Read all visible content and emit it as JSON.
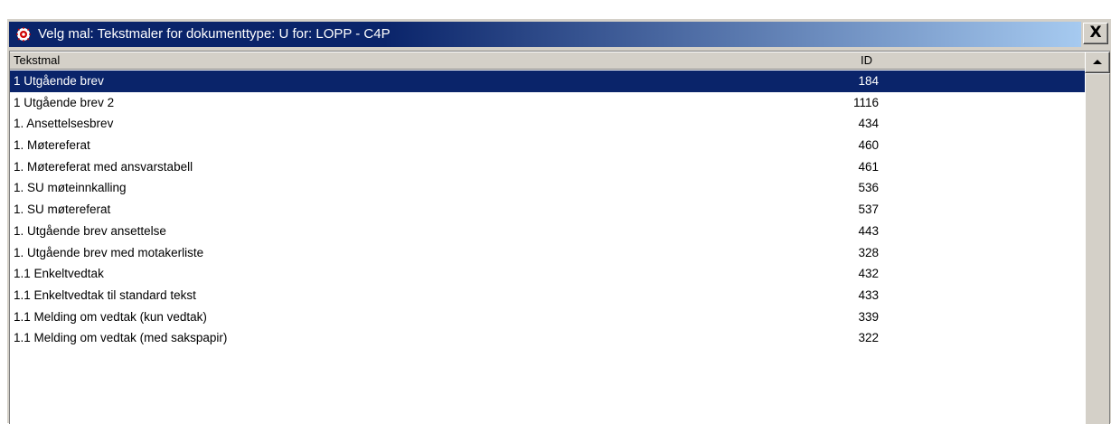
{
  "window": {
    "title": "Velg mal: Tekstmaler for dokumenttype: U for: LOPP - C4P",
    "close_label": "X"
  },
  "list": {
    "headers": {
      "name": "Tekstmal",
      "id": "ID"
    },
    "rows": [
      {
        "name": "1 Utgående brev",
        "id": "184",
        "selected": true
      },
      {
        "name": "1 Utgående brev 2",
        "id": "1116"
      },
      {
        "name": "1. Ansettelsesbrev",
        "id": "434"
      },
      {
        "name": "1. Møtereferat",
        "id": "460"
      },
      {
        "name": "1. Møtereferat med ansvarstabell",
        "id": "461"
      },
      {
        "name": "1. SU møteinnkalling",
        "id": "536"
      },
      {
        "name": "1. SU møtereferat",
        "id": "537"
      },
      {
        "name": "1. Utgående brev ansettelse",
        "id": "443"
      },
      {
        "name": "1. Utgående brev med motakerliste",
        "id": "328"
      },
      {
        "name": "1.1 Enkeltvedtak",
        "id": "432"
      },
      {
        "name": "1.1 Enkeltvedtak til standard tekst",
        "id": "433"
      },
      {
        "name": "1.1 Melding om vedtak (kun vedtak)",
        "id": "339"
      },
      {
        "name": "1.1 Melding om vedtak (med sakspapir)",
        "id": "322"
      }
    ]
  },
  "colors": {
    "selection": "#0a246a",
    "window_face": "#d4d0c8"
  }
}
